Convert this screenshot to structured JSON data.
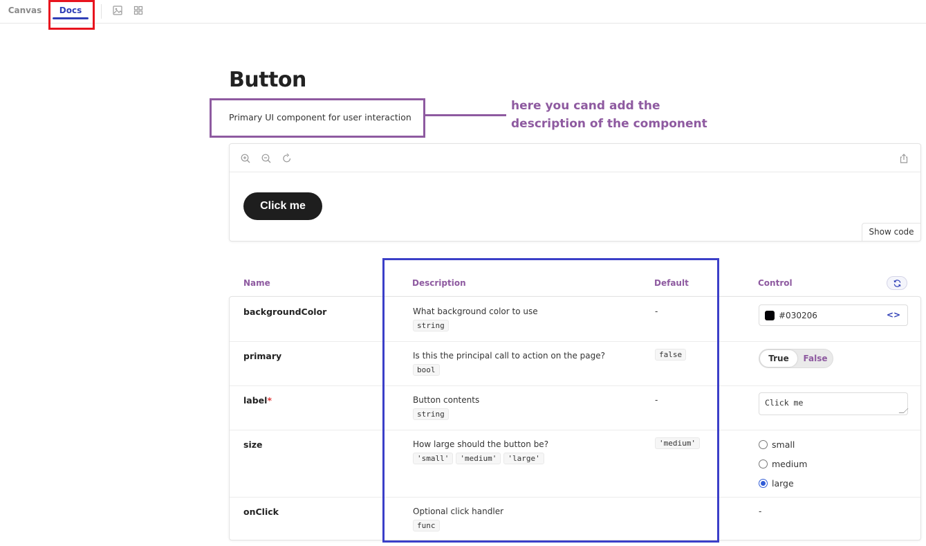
{
  "tabs": {
    "canvas": "Canvas",
    "docs": "Docs"
  },
  "toolbar_icons": [
    "image-icon",
    "grid-icon"
  ],
  "page": {
    "title": "Button",
    "description": "Primary UI component for user interaction",
    "annotation": "here you cand add the description of the component"
  },
  "preview": {
    "icons": [
      "zoom-in-icon",
      "zoom-out-icon",
      "reset-zoom-icon",
      "share-icon"
    ],
    "button_label": "Click me",
    "show_code": "Show code"
  },
  "args_table": {
    "headers": {
      "name": "Name",
      "description": "Description",
      "default": "Default",
      "control": "Control"
    },
    "rows": [
      {
        "name": "backgroundColor",
        "required": false,
        "description": "What background color to use",
        "types": [
          "string"
        ],
        "default": "-",
        "control": {
          "kind": "color",
          "value": "#030206"
        }
      },
      {
        "name": "primary",
        "required": false,
        "description": "Is this the principal call to action on the page?",
        "types": [
          "bool"
        ],
        "default": "false",
        "control": {
          "kind": "toggle",
          "true_label": "True",
          "false_label": "False",
          "selected": "False"
        }
      },
      {
        "name": "label",
        "required": true,
        "description": "Button contents",
        "types": [
          "string"
        ],
        "default": "-",
        "control": {
          "kind": "text",
          "value": "Click me"
        }
      },
      {
        "name": "size",
        "required": false,
        "description": "How large should the button be?",
        "types": [
          "'small'",
          "'medium'",
          "'large'"
        ],
        "default": "'medium'",
        "control": {
          "kind": "radio",
          "options": [
            "small",
            "medium",
            "large"
          ],
          "selected": "large"
        }
      },
      {
        "name": "onClick",
        "required": false,
        "description": "Optional click handler",
        "types": [
          "func"
        ],
        "default": "",
        "control": {
          "kind": "none",
          "value": "-"
        }
      }
    ]
  },
  "colors": {
    "accent": "#2f3fb7",
    "purple": "#8e5aa0",
    "highlight_red": "#e8141e",
    "highlight_blue": "#3b3fc8",
    "swatch": "#030206"
  }
}
